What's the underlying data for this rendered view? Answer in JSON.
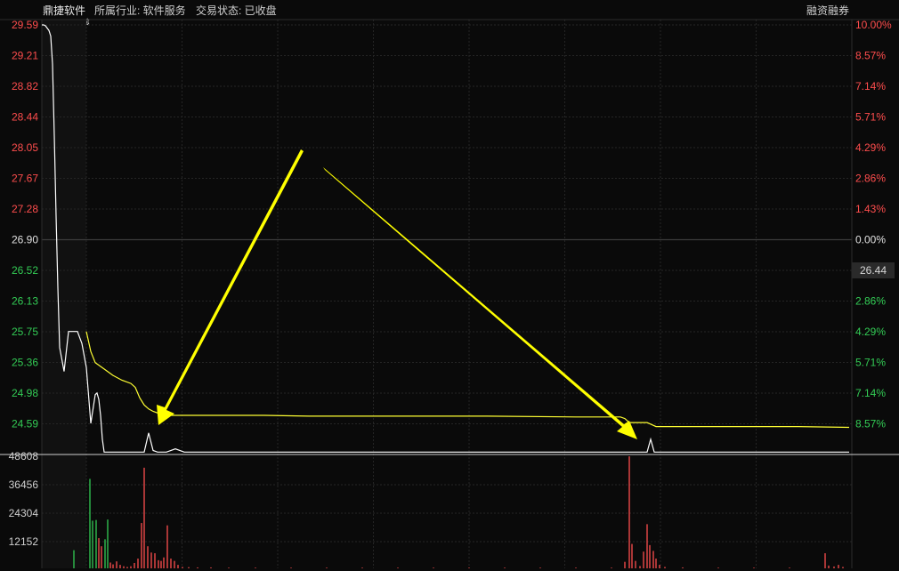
{
  "header": {
    "stock_name": "鼎捷软件",
    "industry": "所属行业: 软件服务",
    "status": "交易状态: 已收盘",
    "margin_label": "融资融券"
  },
  "price_axis": {
    "left_labels": [
      "29.59",
      "29.21",
      "28.82",
      "28.44",
      "28.05",
      "27.67",
      "27.28",
      "26.90",
      "26.52",
      "26.13",
      "25.75",
      "25.36",
      "24.98",
      "24.59"
    ],
    "right_labels": [
      "10.00%",
      "8.57%",
      "7.14%",
      "5.71%",
      "4.29%",
      "2.86%",
      "1.43%",
      "0.00%",
      "",
      "2.86%",
      "4.29%",
      "5.71%",
      "7.14%",
      "8.57%"
    ],
    "current_price": "26.44"
  },
  "volume_axis": {
    "labels": [
      "48608",
      "36456",
      "24304",
      "12152"
    ]
  },
  "colors": {
    "up": "#ff4d4d",
    "down": "#33cc55",
    "neutral": "#e0e0e0",
    "price_line": "#ffffff",
    "avg_line": "#ffff33",
    "annotation": "#ffff00",
    "grid": "#252525"
  },
  "chart_data": {
    "type": "line",
    "price_range": [
      24.21,
      29.59
    ],
    "pre_close": "26.90",
    "series": [
      {
        "x": [
          0,
          2,
          4,
          6,
          8,
          10,
          12,
          14,
          16,
          18,
          20,
          25,
          30,
          35,
          40,
          45,
          50,
          55,
          60,
          62,
          64,
          66,
          68,
          70,
          72,
          74,
          76,
          78,
          80,
          85,
          90,
          95,
          100,
          105,
          110,
          115,
          120,
          125,
          130,
          140,
          150,
          160,
          175,
          200,
          240,
          270,
          300,
          330,
          360,
          400,
          440,
          500,
          560,
          600,
          620,
          640,
          660,
          680,
          684,
          688,
          692,
          700,
          720,
          760,
          800,
          850,
          907
        ],
        "y": [
          29.59,
          29.59,
          29.58,
          29.55,
          29.52,
          29.45,
          29.1,
          28.2,
          27.2,
          26.3,
          25.55,
          25.25,
          25.75,
          25.75,
          25.75,
          25.6,
          25.3,
          24.6,
          24.96,
          24.98,
          24.9,
          24.7,
          24.4,
          24.24,
          24.24,
          24.24,
          24.24,
          24.24,
          24.24,
          24.24,
          24.24,
          24.24,
          24.24,
          24.24,
          24.24,
          24.24,
          24.48,
          24.26,
          24.24,
          24.24,
          24.28,
          24.24,
          24.24,
          24.24,
          24.24,
          24.24,
          24.24,
          24.24,
          24.24,
          24.24,
          24.24,
          24.24,
          24.24,
          24.24,
          24.24,
          24.24,
          24.24,
          24.24,
          24.4,
          24.24,
          24.24,
          24.24,
          24.24,
          24.24,
          24.24,
          24.24,
          24.24
        ]
      },
      {
        "x": [
          50,
          55,
          60,
          70,
          80,
          90,
          100,
          105,
          110,
          115,
          120,
          125,
          130,
          140,
          155,
          170,
          200,
          250,
          300,
          400,
          500,
          600,
          650,
          655,
          660,
          680,
          690,
          700,
          720,
          760,
          800,
          850,
          907
        ],
        "y": [
          25.75,
          25.5,
          25.36,
          25.28,
          25.2,
          25.14,
          25.1,
          25.05,
          24.92,
          24.83,
          24.78,
          24.75,
          24.73,
          24.7,
          24.7,
          24.7,
          24.7,
          24.7,
          24.69,
          24.69,
          24.69,
          24.68,
          24.68,
          24.66,
          24.61,
          24.61,
          24.56,
          24.56,
          24.56,
          24.56,
          24.56,
          24.56,
          24.55
        ]
      }
    ],
    "volume": {
      "range": [
        0,
        48608
      ],
      "bars": [
        {
          "x": 36,
          "v": 7800,
          "c": "down"
        },
        {
          "x": 54,
          "v": 38500,
          "c": "down"
        },
        {
          "x": 57,
          "v": 20500,
          "c": "down"
        },
        {
          "x": 61,
          "v": 20800,
          "c": "down"
        },
        {
          "x": 64,
          "v": 13000,
          "c": "up"
        },
        {
          "x": 67,
          "v": 9500,
          "c": "up"
        },
        {
          "x": 71,
          "v": 12500,
          "c": "down"
        },
        {
          "x": 74,
          "v": 21000,
          "c": "down"
        },
        {
          "x": 77,
          "v": 2500,
          "c": "up"
        },
        {
          "x": 80,
          "v": 1700,
          "c": "up"
        },
        {
          "x": 84,
          "v": 3000,
          "c": "up"
        },
        {
          "x": 88,
          "v": 1500,
          "c": "up"
        },
        {
          "x": 92,
          "v": 900,
          "c": "up"
        },
        {
          "x": 96,
          "v": 600,
          "c": "up"
        },
        {
          "x": 100,
          "v": 900,
          "c": "up"
        },
        {
          "x": 104,
          "v": 2300,
          "c": "up"
        },
        {
          "x": 108,
          "v": 4200,
          "c": "up"
        },
        {
          "x": 112,
          "v": 19500,
          "c": "up"
        },
        {
          "x": 115,
          "v": 43300,
          "c": "up"
        },
        {
          "x": 119,
          "v": 9500,
          "c": "up"
        },
        {
          "x": 123,
          "v": 6800,
          "c": "up"
        },
        {
          "x": 127,
          "v": 6500,
          "c": "up"
        },
        {
          "x": 131,
          "v": 3500,
          "c": "up"
        },
        {
          "x": 134,
          "v": 3200,
          "c": "up"
        },
        {
          "x": 137,
          "v": 4700,
          "c": "up"
        },
        {
          "x": 141,
          "v": 18500,
          "c": "up"
        },
        {
          "x": 145,
          "v": 4200,
          "c": "up"
        },
        {
          "x": 149,
          "v": 3200,
          "c": "up"
        },
        {
          "x": 153,
          "v": 1500,
          "c": "up"
        },
        {
          "x": 158,
          "v": 600,
          "c": "up"
        },
        {
          "x": 165,
          "v": 500,
          "c": "up"
        },
        {
          "x": 175,
          "v": 400,
          "c": "up"
        },
        {
          "x": 190,
          "v": 400,
          "c": "up"
        },
        {
          "x": 210,
          "v": 300,
          "c": "up"
        },
        {
          "x": 240,
          "v": 300,
          "c": "up"
        },
        {
          "x": 280,
          "v": 300,
          "c": "up"
        },
        {
          "x": 320,
          "v": 300,
          "c": "up"
        },
        {
          "x": 360,
          "v": 300,
          "c": "up"
        },
        {
          "x": 400,
          "v": 300,
          "c": "up"
        },
        {
          "x": 440,
          "v": 300,
          "c": "up"
        },
        {
          "x": 480,
          "v": 300,
          "c": "up"
        },
        {
          "x": 520,
          "v": 300,
          "c": "up"
        },
        {
          "x": 560,
          "v": 300,
          "c": "up"
        },
        {
          "x": 600,
          "v": 300,
          "c": "up"
        },
        {
          "x": 640,
          "v": 300,
          "c": "up"
        },
        {
          "x": 655,
          "v": 2800,
          "c": "up"
        },
        {
          "x": 660,
          "v": 48200,
          "c": "up"
        },
        {
          "x": 663,
          "v": 10500,
          "c": "up"
        },
        {
          "x": 667,
          "v": 3200,
          "c": "up"
        },
        {
          "x": 672,
          "v": 1000,
          "c": "up"
        },
        {
          "x": 676,
          "v": 7200,
          "c": "up"
        },
        {
          "x": 680,
          "v": 19000,
          "c": "up"
        },
        {
          "x": 683,
          "v": 10000,
          "c": "up"
        },
        {
          "x": 687,
          "v": 7500,
          "c": "up"
        },
        {
          "x": 690,
          "v": 4200,
          "c": "up"
        },
        {
          "x": 694,
          "v": 1500,
          "c": "up"
        },
        {
          "x": 700,
          "v": 600,
          "c": "up"
        },
        {
          "x": 720,
          "v": 400,
          "c": "up"
        },
        {
          "x": 760,
          "v": 300,
          "c": "up"
        },
        {
          "x": 800,
          "v": 300,
          "c": "up"
        },
        {
          "x": 840,
          "v": 300,
          "c": "up"
        },
        {
          "x": 880,
          "v": 6500,
          "c": "up"
        },
        {
          "x": 884,
          "v": 1200,
          "c": "up"
        },
        {
          "x": 890,
          "v": 800,
          "c": "up"
        },
        {
          "x": 895,
          "v": 1500,
          "c": "up"
        },
        {
          "x": 900,
          "v": 600,
          "c": "up"
        }
      ]
    }
  }
}
